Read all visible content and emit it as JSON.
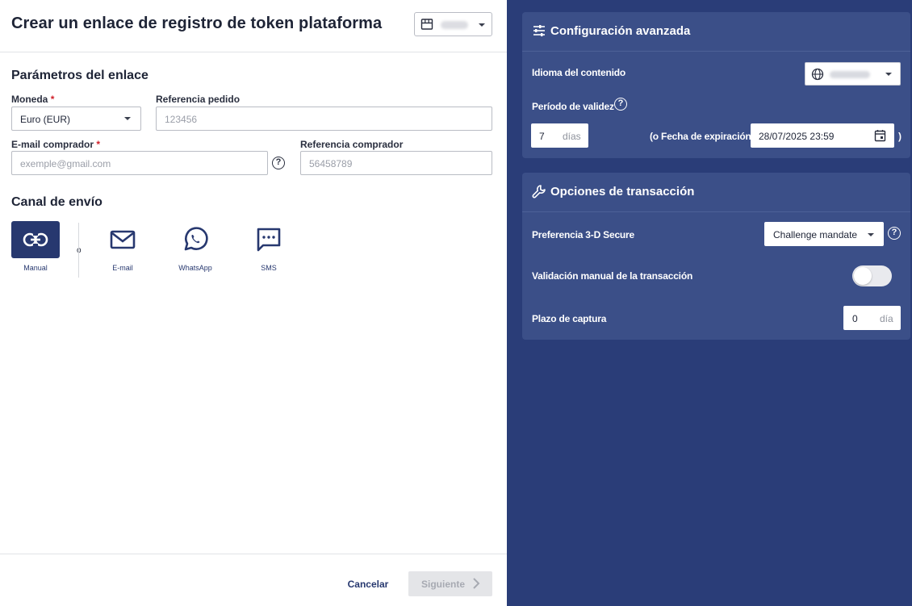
{
  "header": {
    "title": "Crear un enlace de registro de token plataforma",
    "shop_select_icon": "store-icon"
  },
  "params": {
    "section_title": "Parámetros del enlace",
    "currency": {
      "label": "Moneda",
      "required_mark": "*",
      "value": "Euro (EUR)"
    },
    "order_ref": {
      "label": "Referencia pedido",
      "placeholder": "123456"
    },
    "buyer_email": {
      "label": "E-mail comprador",
      "required_mark": "*",
      "placeholder": "exemple@gmail.com",
      "help_icon": "help-circle-icon"
    },
    "buyer_ref": {
      "label": "Referencia comprador",
      "placeholder": "56458789"
    }
  },
  "channel": {
    "section_title": "Canal de envío",
    "separator": "o",
    "options": [
      {
        "label": "Manual",
        "icon": "link-icon",
        "active": true
      },
      {
        "label": "E-mail",
        "icon": "mail-icon",
        "active": false
      },
      {
        "label": "WhatsApp",
        "icon": "whatsapp-icon",
        "active": false
      },
      {
        "label": "SMS",
        "icon": "sms-icon",
        "active": false
      }
    ]
  },
  "footer": {
    "cancel_label": "Cancelar",
    "next_label": "Siguiente"
  },
  "advanced": {
    "title": "Configuración avanzada",
    "icon": "sliders-icon",
    "language_label": "Idioma del contenido",
    "language_icon": "globe-icon",
    "validity_label": "Período de validez",
    "validity_value": "7",
    "validity_unit": "días",
    "expiry_label": "(o Fecha de expiración",
    "expiry_value": "28/07/2025 23:59",
    "expiry_close": ")",
    "calendar_icon": "calendar-icon"
  },
  "transaction": {
    "title": "Opciones de transacción",
    "icon": "wrench-icon",
    "secure_label": "Preferencia 3-D Secure",
    "secure_value": "Challenge mandate",
    "manual_validation_label": "Validación manual de la transacción",
    "manual_validation_on": false,
    "capture_label": "Plazo de captura",
    "capture_value": "0",
    "capture_unit": "día"
  },
  "colors": {
    "accent": "#27386f",
    "right_panel": "#2a3d78",
    "card": "#3b4f88",
    "required": "#d0202a"
  }
}
